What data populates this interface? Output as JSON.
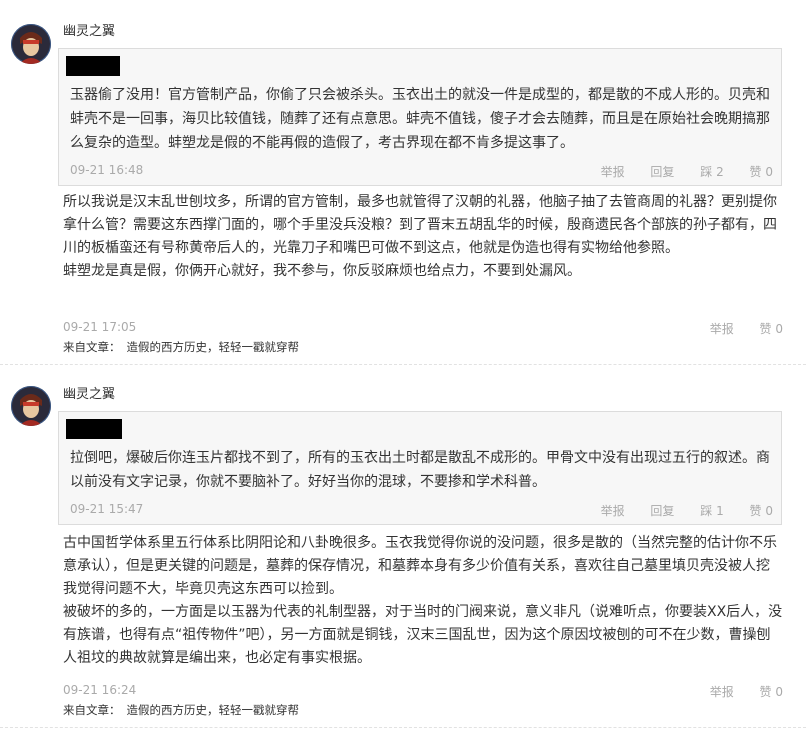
{
  "comments": [
    {
      "username": "幽灵之翼",
      "quote": {
        "text": "玉器偷了没用！官方管制产品，你偷了只会被杀头。玉衣出土的就没一件是成型的，都是散的不成人形的。贝壳和蚌壳不是一回事，海贝比较值钱，随葬了还有点意思。蚌壳不值钱，傻子才会去随葬，而且是在原始社会晚期搞那么复杂的造型。蚌塑龙是假的不能再假的造假了，考古界现在都不肯多提这事了。",
        "time": "09-21 16:48",
        "report": "举报",
        "reply": "回复",
        "dislike": "踩 2",
        "like": "赞 0"
      },
      "paragraphs": [
        "所以我说是汉末乱世刨坟多，所谓的官方管制，最多也就管得了汉朝的礼器，他脑子抽了去管商周的礼器？更别提你拿什么管？需要这东西撑门面的，哪个手里没兵没粮？到了晋末五胡乱华的时候，殷商遗民各个部族的孙子都有，四川的板楯蛮还有号称黄帝后人的，光靠刀子和嘴巴可做不到这点，他就是伪造也得有实物给他参照。",
        "蚌塑龙是真是假，你俩开心就好，我不参与，你反驳麻烦也给点力，不要到处漏风。"
      ],
      "time": "09-21 17:05",
      "report": "举报",
      "like": "赞 0",
      "source_label": "来自文章：",
      "source_title": "造假的西方历史，轻轻一戳就穿帮"
    },
    {
      "username": "幽灵之翼",
      "quote": {
        "text": "拉倒吧，爆破后你连玉片都找不到了，所有的玉衣出土时都是散乱不成形的。甲骨文中没有出现过五行的叙述。商以前没有文字记录，你就不要脑补了。好好当你的混球，不要掺和学术科普。",
        "time": "09-21 15:47",
        "report": "举报",
        "reply": "回复",
        "dislike": "踩 1",
        "like": "赞 0"
      },
      "paragraphs": [
        "古中国哲学体系里五行体系比阴阳论和八卦晚很多。玉衣我觉得你说的没问题，很多是散的（当然完整的估计你不乐意承认），但是更关键的问题是，墓葬的保存情况，和墓葬本身有多少价值有关系，喜欢往自己墓里填贝壳没被人挖我觉得问题不大，毕竟贝壳这东西可以捡到。",
        "被破坏的多的，一方面是以玉器为代表的礼制型器，对于当时的门阀来说，意义非凡（说难听点，你要装XX后人，没有族谱，也得有点“祖传物件”吧），另一方面就是铜钱，汉末三国乱世，因为这个原因坟被刨的可不在少数，曹操刨人祖坟的典故就算是编出来，也必定有事实根据。"
      ],
      "time": "09-21 16:24",
      "report": "举报",
      "like": "赞 0",
      "source_label": "来自文章：",
      "source_title": "造假的西方历史，轻轻一戳就穿帮"
    }
  ]
}
